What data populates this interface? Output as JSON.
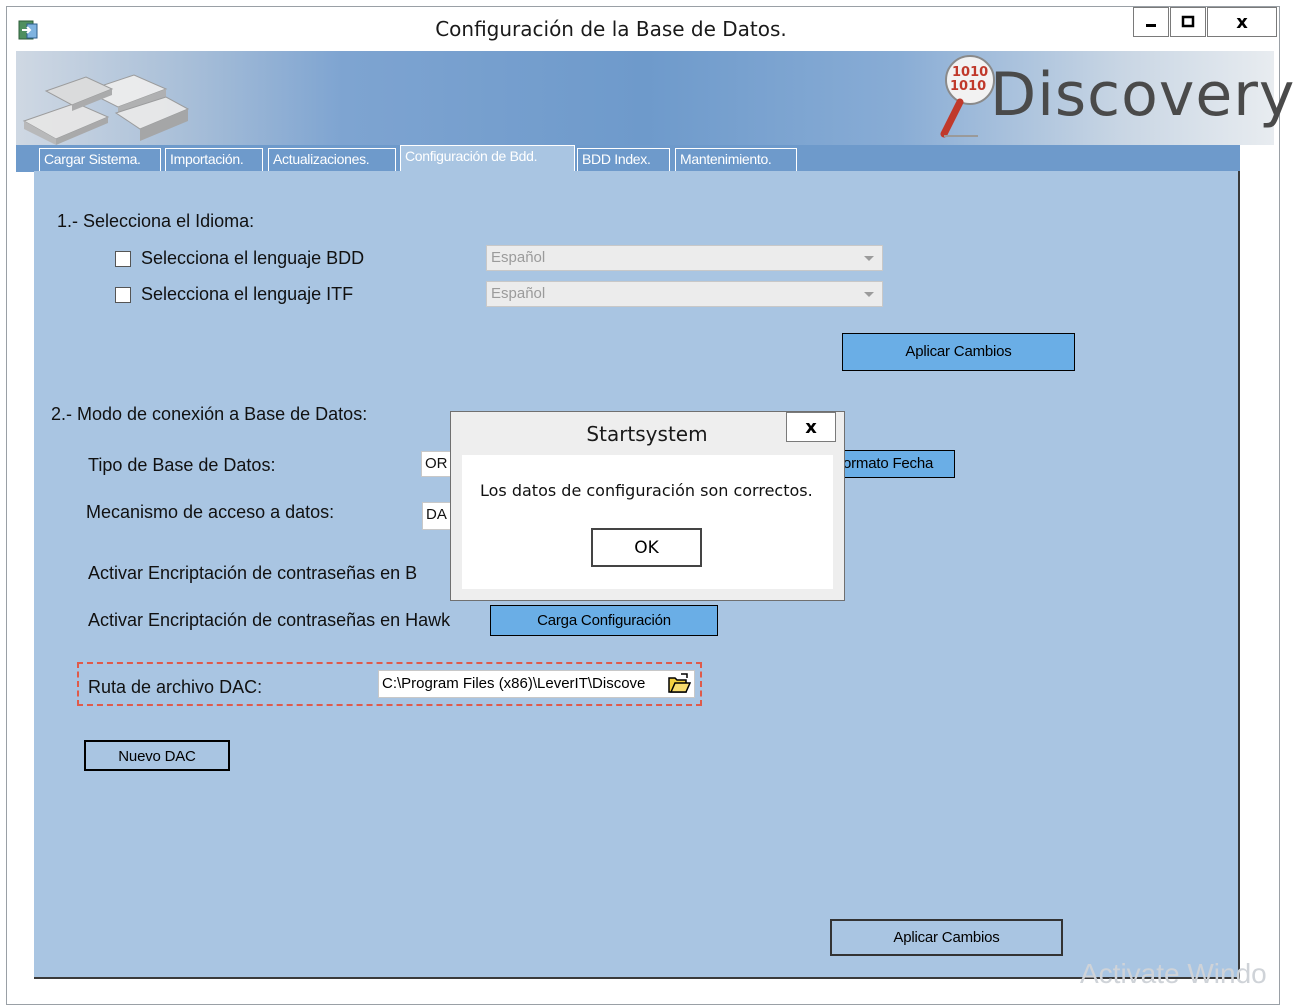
{
  "window": {
    "title": "Configuración de la Base de Datos.",
    "close_glyph": "x"
  },
  "banner": {
    "logo_text": "Discovery",
    "logo_digits": "1010"
  },
  "tabs": [
    {
      "label": "Cargar Sistema."
    },
    {
      "label": "Importación."
    },
    {
      "label": "Actualizaciones."
    },
    {
      "label": "Configuración de Bdd."
    },
    {
      "label": "BDD Index."
    },
    {
      "label": "Mantenimiento."
    }
  ],
  "section1": {
    "heading": "1.- Selecciona el Idioma:",
    "bdd_language_label": "Selecciona el lenguaje BDD",
    "bdd_language_value": "Español",
    "itf_language_label": "Selecciona el lenguaje ITF",
    "itf_language_value": "Español",
    "apply_button": "Aplicar Cambios"
  },
  "section2": {
    "heading": "2.- Modo de conexión a Base de Datos:",
    "db_type_label": "Tipo de Base de Datos:",
    "db_type_value": "OR",
    "date_format_button": "ormato Fecha",
    "access_label": "Mecanismo de acceso a datos:",
    "access_value": "DA",
    "encrypt_b_label": "Activar Encriptación de contraseñas en B",
    "encrypt_hawk_label": "Activar Encriptación de contraseñas en Hawk",
    "load_config_button": "Carga Configuración",
    "dac_path_label": "Ruta de archivo DAC:",
    "dac_path_value": "C:\\Program Files (x86)\\LeverIT\\Discove",
    "new_dac_button": "Nuevo DAC",
    "apply_button": "Aplicar Cambios"
  },
  "dialog": {
    "title": "Startsystem",
    "close_glyph": "x",
    "message": "Los datos de configuración son correctos.",
    "ok_button": "OK"
  },
  "watermark": "Activate Windo"
}
